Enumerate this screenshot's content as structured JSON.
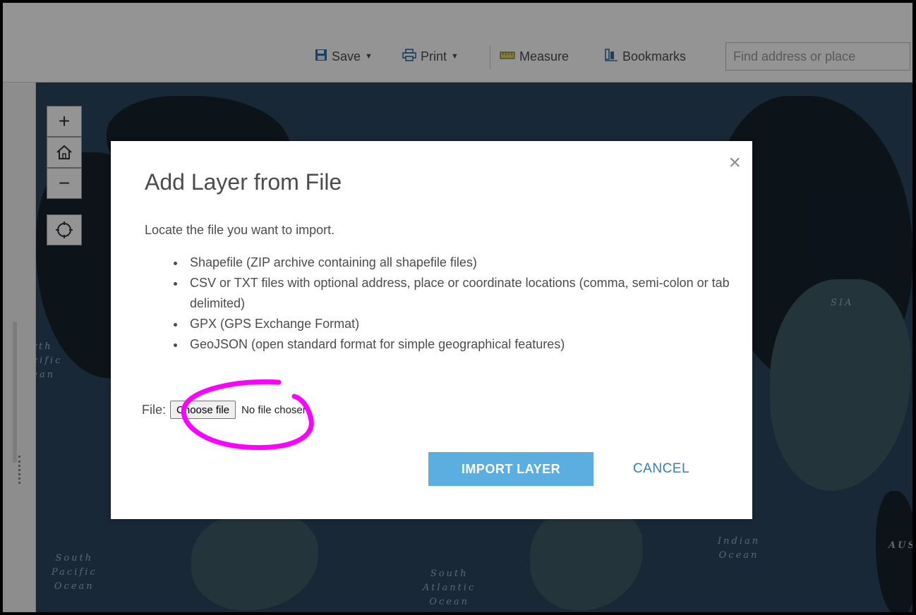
{
  "toolbar": {
    "save_label": "Save",
    "print_label": "Print",
    "measure_label": "Measure",
    "bookmarks_label": "Bookmarks",
    "search_placeholder": "Find address or place"
  },
  "map": {
    "ocean_labels": {
      "north_pacific": "orth\nacific\ncean",
      "south_pacific": "South\nPacific\nOcean",
      "south_atlantic": "South\nAtlantic\nOcean",
      "indian": "Indian\nOcean",
      "asia": "SIA",
      "aus": "AUS"
    },
    "zoom_in": "+",
    "zoom_out": "−"
  },
  "dialog": {
    "title": "Add Layer from File",
    "intro": "Locate the file you want to import.",
    "formats": [
      "Shapefile (ZIP archive containing all shapefile files)",
      "CSV or TXT files with optional address, place or coordinate locations (comma, semi-colon or tab delimited)",
      "GPX (GPS Exchange Format)",
      "GeoJSON (open standard format for simple geographical features)"
    ],
    "file_label": "File:",
    "choose_file": "Choose file",
    "no_file": "No file chosen",
    "import_label": "IMPORT LAYER",
    "cancel_label": "CANCEL",
    "close": "×"
  },
  "colors": {
    "accent": "#5aaee0",
    "link": "#2f7fc2",
    "annotation": "#ff00ff"
  }
}
